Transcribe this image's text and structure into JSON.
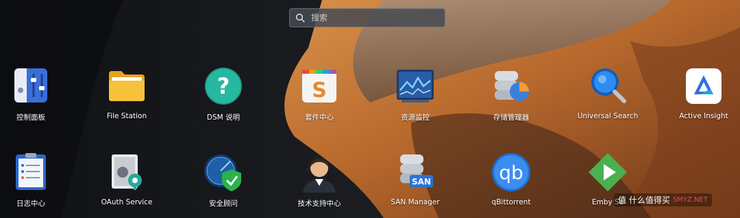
{
  "search": {
    "placeholder": "搜索"
  },
  "apps": [
    {
      "label": "控制面板",
      "icon": "control-panel-icon"
    },
    {
      "label": "File Station",
      "icon": "folder-icon"
    },
    {
      "label": "DSM 说明",
      "icon": "help-icon"
    },
    {
      "label": "套件中心",
      "icon": "package-center-icon"
    },
    {
      "label": "资源监控",
      "icon": "resource-monitor-icon"
    },
    {
      "label": "存储管理器",
      "icon": "storage-manager-icon"
    },
    {
      "label": "Universal Search",
      "icon": "universal-search-icon"
    },
    {
      "label": "Active Insight",
      "icon": "active-insight-icon"
    },
    {
      "label": "日志中心",
      "icon": "log-center-icon"
    },
    {
      "label": "OAuth Service",
      "icon": "oauth-service-icon"
    },
    {
      "label": "安全顾问",
      "icon": "security-advisor-icon"
    },
    {
      "label": "技术支持中心",
      "icon": "support-center-icon"
    },
    {
      "label": "SAN Manager",
      "icon": "san-manager-icon"
    },
    {
      "label": "qBittorrent",
      "icon": "qbittorrent-icon"
    },
    {
      "label": "Emby Se",
      "icon": "emby-server-icon"
    }
  ],
  "watermark": {
    "text1": "值 什么值得买",
    "text2": "SMYZ.NET"
  },
  "colors": {
    "background_dark": "#15171c",
    "desert_orange": "#c77a3e",
    "search_bg": "#464a52"
  }
}
